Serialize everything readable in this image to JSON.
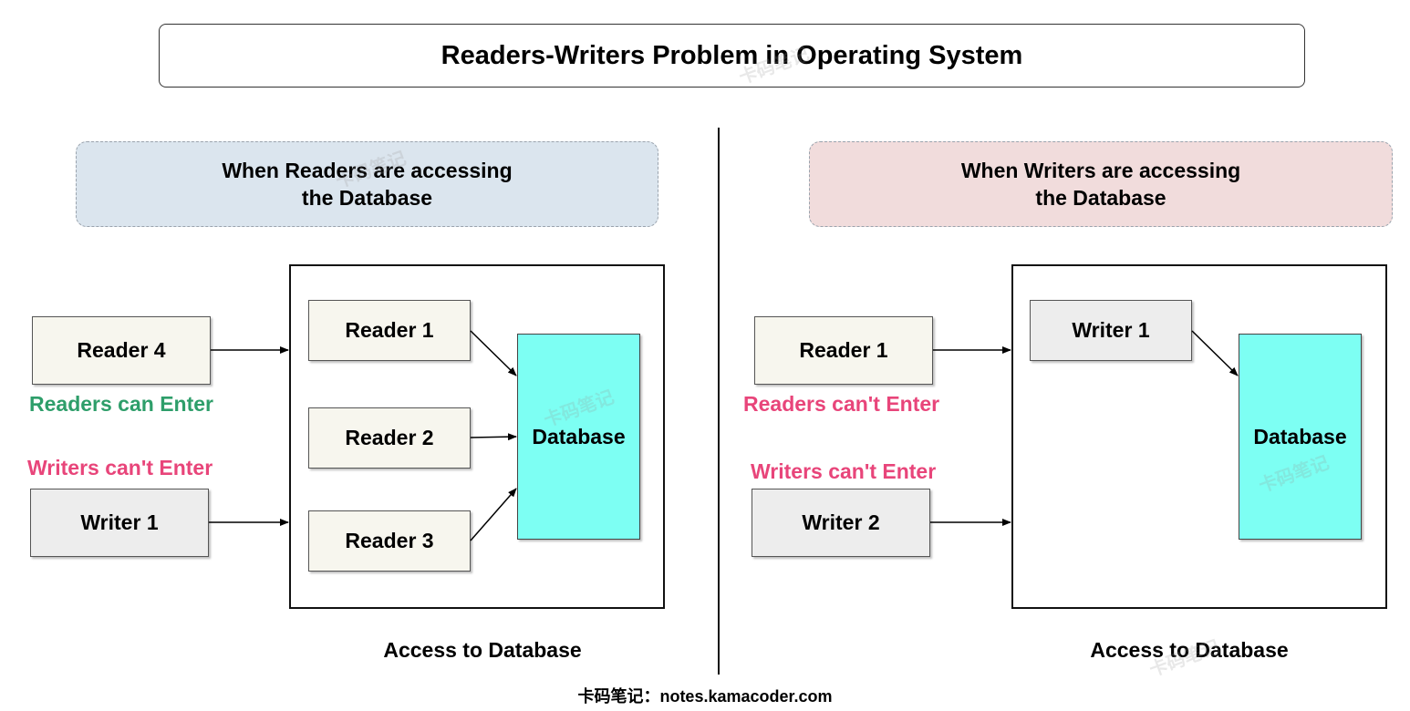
{
  "title": "Readers-Writers Problem in Operating System",
  "colors": {
    "readers_banner_bg": "#dbe5ee",
    "writers_banner_bg": "#f1dcdc",
    "database_fill": "#7dfff3",
    "allowed_text": "#2e9e6a",
    "denied_text": "#e8457a",
    "reader_fill": "#f7f6ee",
    "writer_fill": "#ededed"
  },
  "left_panel": {
    "banner_line1": "When Readers are accessing",
    "banner_line2": "the Database",
    "outside_reader": "Reader 4",
    "readers_status": "Readers can Enter",
    "writers_status": "Writers can't Enter",
    "outside_writer": "Writer 1",
    "inside": [
      "Reader 1",
      "Reader 2",
      "Reader 3"
    ],
    "database": "Database",
    "caption": "Access to Database"
  },
  "right_panel": {
    "banner_line1": "When Writers are accessing",
    "banner_line2": "the Database",
    "outside_reader": "Reader 1",
    "readers_status": "Readers can't Enter",
    "writers_status": "Writers can't Enter",
    "outside_writer": "Writer 2",
    "inside_writer": "Writer 1",
    "database": "Database",
    "caption": "Access to Database"
  },
  "watermark": "卡码笔记",
  "footer": "卡码笔记：notes.kamacoder.com"
}
